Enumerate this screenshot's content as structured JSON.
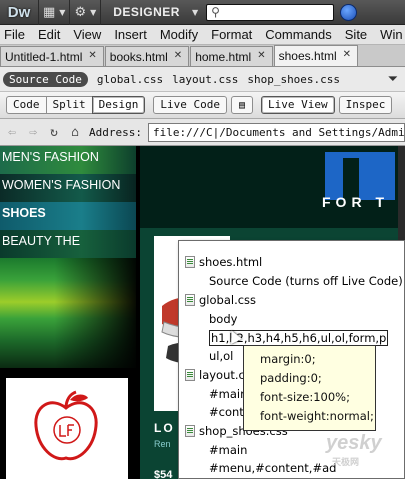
{
  "titlebar": {
    "logo": "Dw",
    "workspace": "DESIGNER",
    "search_value": ""
  },
  "menu": [
    "File",
    "Edit",
    "View",
    "Insert",
    "Modify",
    "Format",
    "Commands",
    "Site",
    "Win"
  ],
  "doc_tabs": [
    {
      "label": "Untitled-1.html",
      "active": false
    },
    {
      "label": "books.html",
      "active": false
    },
    {
      "label": "home.html",
      "active": false
    },
    {
      "label": "shoes.html",
      "active": true
    }
  ],
  "related_files": {
    "source": "Source Code",
    "files": [
      "global.css",
      "layout.css",
      "shop_shoes.css"
    ]
  },
  "view_toolbar": {
    "code": "Code",
    "split": "Split",
    "design": "Design",
    "live_code": "Live Code",
    "live_view": "Live View",
    "inspect": "Inspec"
  },
  "address": {
    "label": "Address:",
    "value": "file:///C|/Documents and Settings/Administ"
  },
  "page_nav": [
    "MEN'S FASHION",
    "WOMEN'S FASHION",
    "SHOES",
    "BEAUTY THE"
  ],
  "page": {
    "brand_text": "FOR T",
    "product_title": "LO",
    "product_sub": "Ren",
    "price": "$54"
  },
  "popup": {
    "file1": "shoes.html",
    "file1_sub": "Source Code (turns off Live Code)",
    "file2": "global.css",
    "body": "body",
    "selector": "h1,h2,h3,h4,h5,h6,ul,ol,form,p",
    "selector_cont": "ul,ol",
    "file3": "layout.c",
    "main": "#main",
    "content": "#cont",
    "file4": "shop_shoes.css",
    "main2": "#main",
    "menu_sel": "#menu,#content,#ad"
  },
  "tooltip": {
    "lines": [
      "margin:0;",
      "padding:0;",
      "font-size:100%;",
      "font-weight:normal;"
    ]
  },
  "watermark": {
    "main": "yesky",
    "sub": "天极网"
  },
  "colors": {
    "accent_blue": "#1d66c6",
    "nav_shoes": "#1a7e8a",
    "tooltip_bg": "#ffffe1"
  }
}
